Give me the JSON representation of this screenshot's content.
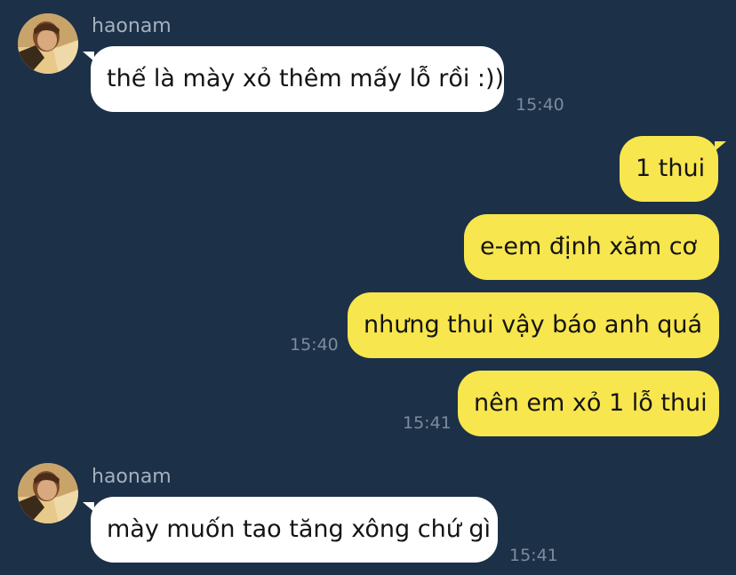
{
  "messages": [
    {
      "sender": "haonam",
      "text": "thế là mày xỏ thêm mấy lỗ rồi :))",
      "time": "15:40"
    },
    {
      "text": "1 thui"
    },
    {
      "text": "e-em định xăm cơ"
    },
    {
      "text": "nhưng thui vậy báo anh quá",
      "time": "15:40"
    },
    {
      "text": "nên em xỏ 1 lỗ thui",
      "time": "15:41"
    },
    {
      "sender": "haonam",
      "text": "mày muốn tao tăng xông chứ gì",
      "time": "15:41"
    }
  ],
  "colors": {
    "background": "#1c3048",
    "incoming_bubble": "#ffffff",
    "outgoing_bubble": "#f8e64e",
    "sender_name": "#a4b0bd",
    "timestamp": "#7d8b9c"
  }
}
